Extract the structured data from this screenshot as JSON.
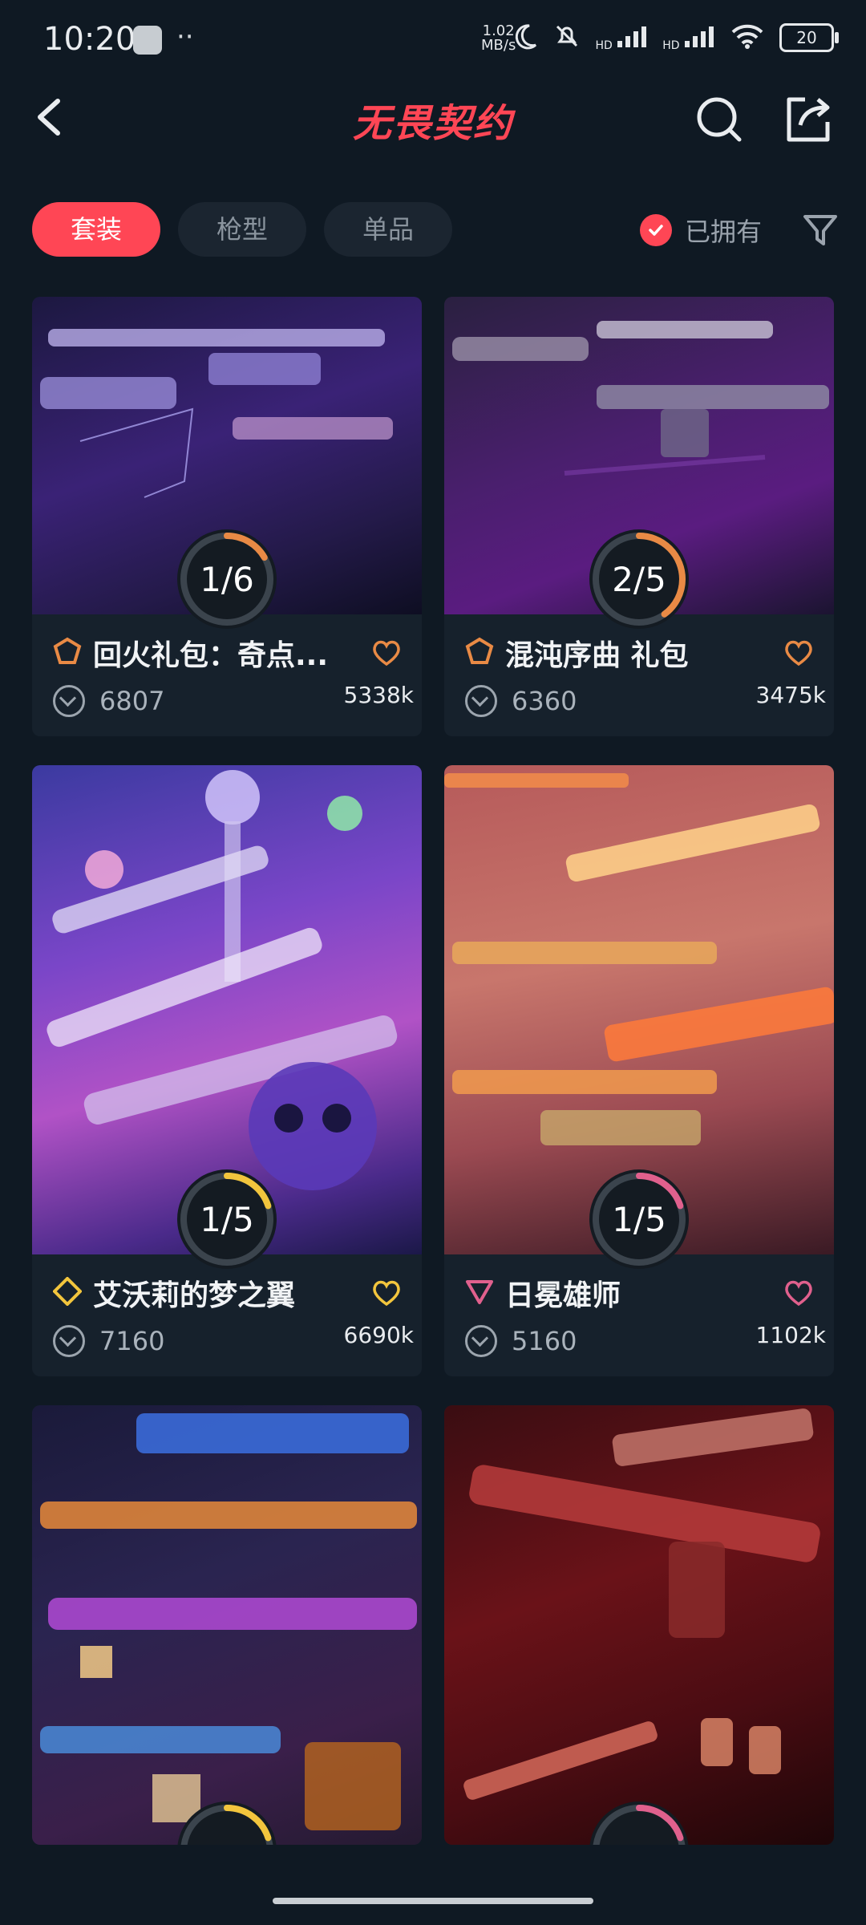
{
  "status_bar": {
    "time": "10:20",
    "dots": "··",
    "net_speed_value": "1.02",
    "net_speed_unit": "MB/s",
    "hd1": "HD",
    "hd2": "HD",
    "battery": "20"
  },
  "header": {
    "brand": "无畏契约"
  },
  "tabs": [
    {
      "label": "套装",
      "active": true
    },
    {
      "label": "枪型",
      "active": false
    },
    {
      "label": "单品",
      "active": false
    }
  ],
  "owned_filter": {
    "label": "已拥有",
    "checked": true
  },
  "cards": [
    {
      "name": "回火礼包：奇点...",
      "progress": "1/6",
      "progress_fraction": 0.1667,
      "vp": "6807",
      "likes": "5338k",
      "tier_color": "#e98a45",
      "heart_color": "#e98a45",
      "ring_color": "#e98a45"
    },
    {
      "name": "混沌序曲 礼包",
      "progress": "2/5",
      "progress_fraction": 0.4,
      "vp": "6360",
      "likes": "3475k",
      "tier_color": "#e98a45",
      "heart_color": "#e98a45",
      "ring_color": "#e98a45"
    },
    {
      "name": "艾沃莉的梦之翼",
      "progress": "1/5",
      "progress_fraction": 0.2,
      "vp": "7160",
      "likes": "6690k",
      "tier_color": "#f2c53d",
      "heart_color": "#f2c53d",
      "ring_color": "#f2c53d"
    },
    {
      "name": "日冕雄师",
      "progress": "1/5",
      "progress_fraction": 0.2,
      "vp": "5160",
      "likes": "1102k",
      "tier_color": "#e0608d",
      "heart_color": "#e0608d",
      "ring_color": "#e0608d"
    },
    {
      "name": "",
      "progress": "",
      "progress_fraction": 0.2,
      "vp": "",
      "likes": "",
      "tier_color": "#f2c53d",
      "heart_color": "#f2c53d",
      "ring_color": "#f2c53d"
    },
    {
      "name": "",
      "progress": "",
      "progress_fraction": 0.2,
      "vp": "",
      "likes": "",
      "tier_color": "#e0608d",
      "heart_color": "#e0608d",
      "ring_color": "#e0608d"
    }
  ],
  "colors": {
    "accent": "#ff4655",
    "background": "#0f1923",
    "card": "#16212c"
  }
}
